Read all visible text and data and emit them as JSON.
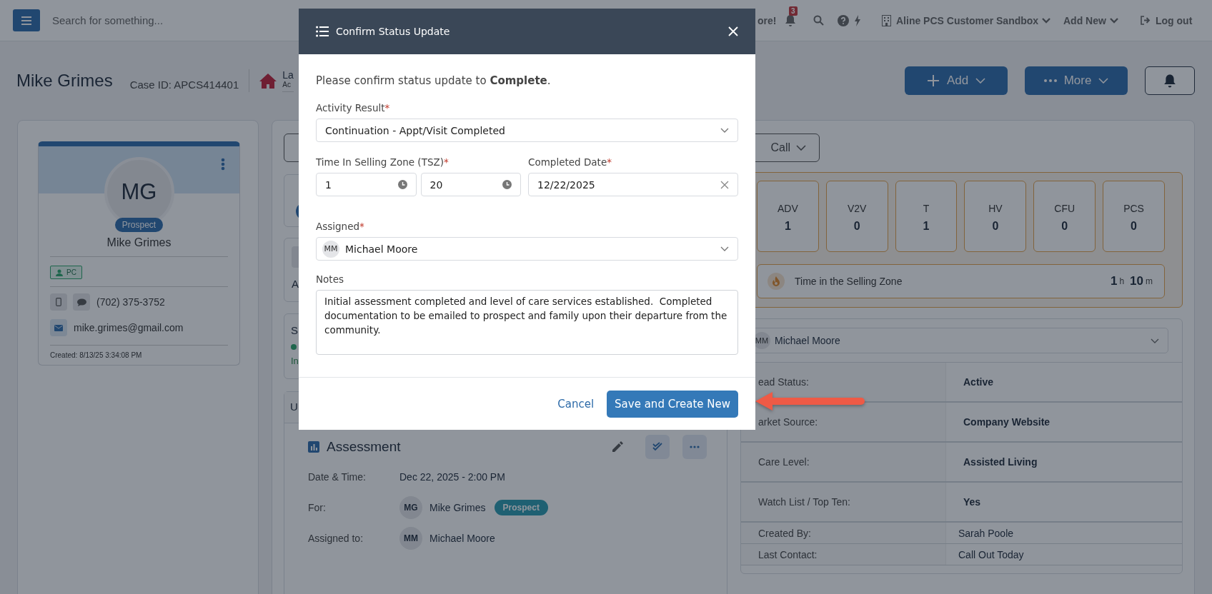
{
  "top_bar": {
    "search_placeholder": "Search for something...",
    "partial_text": "ore!",
    "notification_count": "3",
    "organization": "Aline PCS Customer Sandbox",
    "add_new": "Add New",
    "logout": "Log out"
  },
  "header": {
    "name": "Mike Grimes",
    "case_id": "Case ID: APCS414401",
    "location_partial": "La",
    "location_sub_partial": "Ac",
    "add_button": "Add",
    "more_button": "More"
  },
  "profile": {
    "initials": "MG",
    "badge": "Prospect",
    "name": "Mike Grimes",
    "tag": "PC",
    "phone": "(702) 375-3752",
    "email": "mike.grimes@gmail.com",
    "created": "Created: 8/13/25 3:34:08 PM"
  },
  "middle_column": {
    "card_2_text": "A",
    "card_3_title": "S",
    "card_3_status": "In",
    "card_4_title": "U"
  },
  "activity": {
    "title": "Assessment",
    "rows": [
      {
        "label": "Date & Time:",
        "value": "Dec 22, 2025 - 2:00 PM"
      },
      {
        "label": "For:",
        "initials": "MG",
        "value": "Mike Grimes",
        "badge": "Prospect"
      },
      {
        "label": "Assigned to:",
        "initials": "MM",
        "value": "Michael Moore"
      }
    ]
  },
  "call_button": "Call",
  "counters": [
    {
      "label": "ADV",
      "value": "1"
    },
    {
      "label": "V2V",
      "value": "0"
    },
    {
      "label": "T",
      "value": "1"
    },
    {
      "label": "HV",
      "value": "0"
    },
    {
      "label": "CFU",
      "value": "0"
    },
    {
      "label": "PCS",
      "value": "0"
    }
  ],
  "selling_zone": {
    "label": "Time in the Selling Zone",
    "hours": "1",
    "hours_unit": "h",
    "minutes": "10",
    "minutes_unit": "m"
  },
  "details": {
    "assignee_initials": "MM",
    "assignee": "Michael Moore",
    "rows": [
      {
        "label": "ead Status:",
        "value": "Active",
        "kind": "major"
      },
      {
        "label": "arket Source:",
        "value": "Company Website",
        "kind": "major"
      },
      {
        "label": "Care Level:",
        "value": "Assisted Living",
        "kind": "major"
      },
      {
        "label": "Watch List / Top Ten:",
        "value": "Yes",
        "kind": "major"
      },
      {
        "label": "Created By:",
        "value": "Sarah Poole",
        "kind": "minor"
      },
      {
        "label": "Last Contact:",
        "value": "Call Out Today",
        "kind": "minor"
      }
    ]
  },
  "modal": {
    "title": "Confirm Status Update",
    "intro": "Please confirm status update to **Complete**.",
    "required_mark": "*",
    "activity_result": {
      "label": "Activity Result",
      "value": "Continuation - Appt/Visit Completed"
    },
    "tsz": {
      "label": "Time In Selling Zone (TSZ)",
      "hours": "1",
      "minutes": "20"
    },
    "completed_date": {
      "label": "Completed Date",
      "value": "12/22/2025"
    },
    "assigned": {
      "label": "Assigned",
      "initials": "MM",
      "value": "Michael Moore"
    },
    "notes": {
      "label": "Notes",
      "value": "Initial assessment completed and level of care services established.  Completed documentation to be emailed to prospect and family upon their departure from the community."
    },
    "cancel": "Cancel",
    "save": "Save and Create New"
  }
}
